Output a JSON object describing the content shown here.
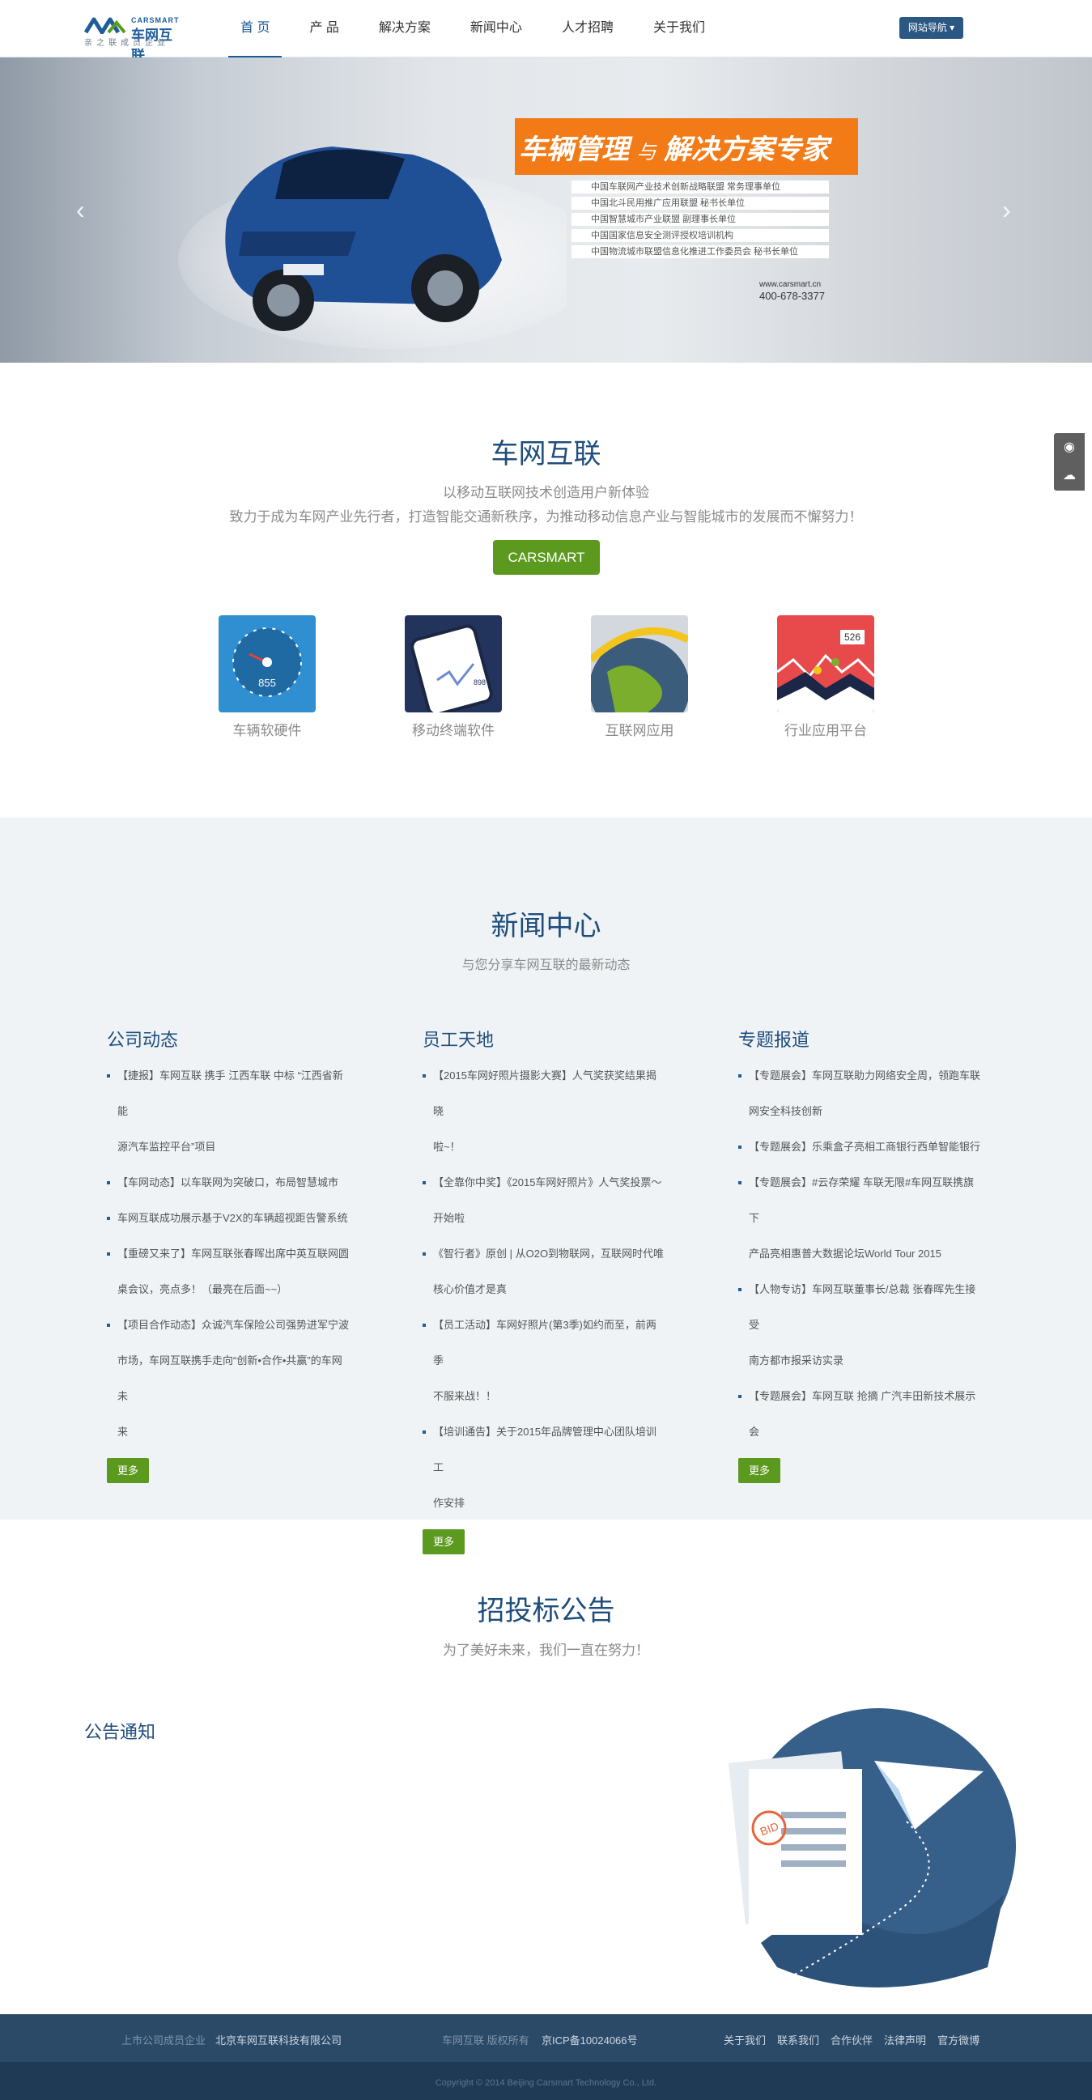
{
  "header": {
    "logo_en": "CARSMART",
    "logo_cn": "车网互联",
    "logo_sub": "亲之联成员企业",
    "nav": [
      "首 页",
      "产 品",
      "解决方案",
      "新闻中心",
      "人才招聘",
      "关于我们"
    ],
    "site_nav": "网站导航 ▾"
  },
  "banner": {
    "title_a": "车辆管理",
    "title_b": "与",
    "title_c": "解决方案专家",
    "lines": [
      "中国车联网产业技术创新战略联盟 常务理事单位",
      "中国北斗民用推广应用联盟 秘书长单位",
      "中国智慧城市产业联盟 副理事长单位",
      "中国国家信息安全测评授权培训机构",
      "中国物流城市联盟信息化推进工作委员会 秘书长单位"
    ],
    "url": "www.carsmart.cn",
    "phone": "400-678-3377"
  },
  "intro": {
    "title": "车网互联",
    "line1": "以移动互联网技术创造用户新体验",
    "line2": "致力于成为车网产业先行者，打造智能交通新秩序，为推动移动信息产业与智能城市的发展而不懈努力！",
    "button": "CARSMART",
    "features": [
      {
        "label": "车辆软硬件",
        "badge": "855"
      },
      {
        "label": "移动终端软件",
        "badge": "898"
      },
      {
        "label": "互联网应用",
        "badge": ""
      },
      {
        "label": "行业应用平台",
        "badge": "526"
      }
    ]
  },
  "news": {
    "title": "新闻中心",
    "subtitle": "与您分享车网互联的最新动态",
    "more": "更多",
    "columns": [
      {
        "title": "公司动态",
        "items": [
          "【捷报】车网互联 携手 江西车联 中标 “江西省新能",
          "源汽车监控平台”项目",
          "【车网动态】以车联网为突破口，布局智慧城市",
          "车网互联成功展示基于V2X的车辆超视距告警系统",
          "【重磅又来了】车网互联张春晖出席中英互联网圆",
          "桌会议，亮点多！（最亮在后面~~）",
          "【项目合作动态】众诚汽车保险公司强势进军宁波",
          "市场，车网互联携手走向“创新•合作•共赢”的车网未",
          "来"
        ]
      },
      {
        "title": "员工天地",
        "items": [
          "【2015车网好照片摄影大赛】人气奖获奖结果揭晓",
          "啦~！",
          "【全靠你中奖】《2015车网好照片》人气奖投票～",
          "开始啦",
          "《智行者》原创 | 从O2O到物联网，互联网时代唯",
          "核心价值才是真",
          "【员工活动】车网好照片(第3季)如约而至，前两季",
          "不服来战！！",
          "【培训通告】关于2015年品牌管理中心团队培训工",
          "作安排"
        ]
      },
      {
        "title": "专题报道",
        "items": [
          "【专题展会】车网互联助力网络安全周，领跑车联",
          "网安全科技创新",
          "【专题展会】乐乘盒子亮相工商银行西单智能银行",
          "【专题展会】#云存荣耀 车联无限#车网互联携旗下",
          "产品亮相惠普大数据论坛World Tour 2015",
          "【人物专访】车网互联董事长/总裁 张春晖先生接受",
          "南方都市报采访实录",
          "【专题展会】车网互联 抢摘 广汽丰田新技术展示会"
        ]
      }
    ]
  },
  "bid": {
    "title": "招投标公告",
    "subtitle": "为了美好未来，我们一直在努力！",
    "notice_title": "公告通知",
    "stamp": "BID"
  },
  "footer": {
    "member_label": "上市公司成员企业",
    "company": "北京车网互联科技有限公司",
    "rights_label": "车网互联 版权所有",
    "icp": "京ICP备10024066号",
    "links": [
      "关于我们",
      "联系我们",
      "合作伙伴",
      "法律声明",
      "官方微博"
    ],
    "copyright": "Copyright © 2014 Beijing Carsmart Technology Co., Ltd."
  },
  "colors": {
    "brand_blue": "#1f4d7c",
    "accent_green": "#5b9a1e",
    "banner_orange": "#f27b17",
    "footer_bg": "#1f3a55"
  }
}
